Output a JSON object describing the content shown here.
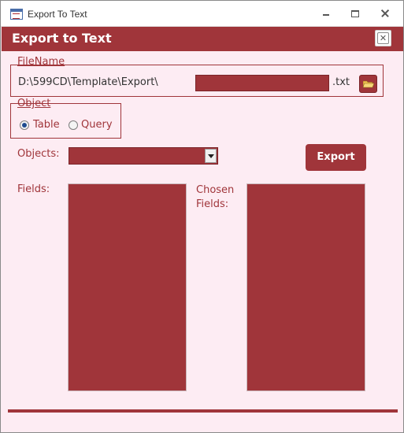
{
  "window": {
    "title": "Export To Text"
  },
  "form": {
    "title": "Export to Text",
    "close_glyph": "✕"
  },
  "filename_group": {
    "label": "FileName",
    "path": "D:\\599CD\\Template\\Export\\",
    "filename_value": "",
    "extension": ".txt",
    "browse_icon": "folder-icon"
  },
  "object_group": {
    "label": "Object",
    "options": [
      {
        "label": "Table",
        "selected": true
      },
      {
        "label": "Query",
        "selected": false
      }
    ]
  },
  "objects": {
    "label": "Objects:",
    "selected_value": ""
  },
  "export_button": {
    "label": "Export"
  },
  "fields": {
    "label": "Fields:",
    "items": []
  },
  "chosen_fields": {
    "label": "Chosen Fields:",
    "items": []
  },
  "colors": {
    "accent": "#a0353a",
    "background": "#fdecf3",
    "radio_selected": "#1e4b8f"
  }
}
